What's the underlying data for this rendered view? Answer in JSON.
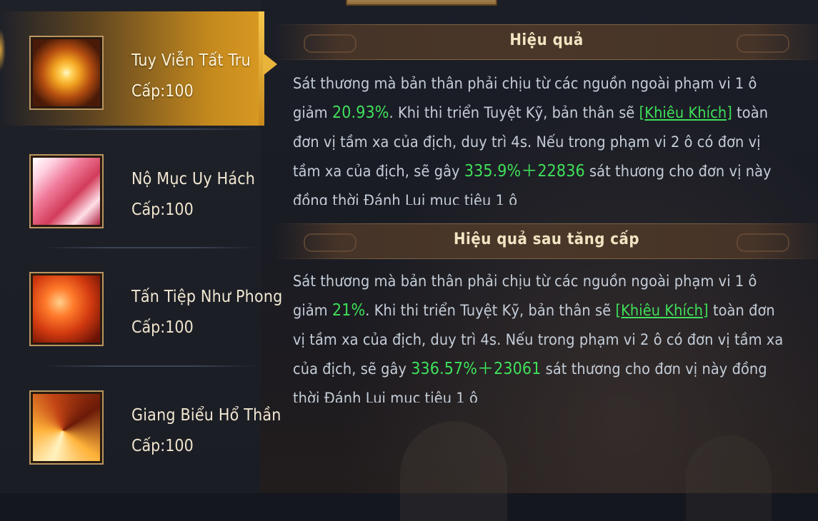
{
  "skills": [
    {
      "name": "Tuy Viễn Tất Tru",
      "level": "Cấp:100",
      "icon": "golden-shield-skill-icon",
      "selected": true
    },
    {
      "name": "Nộ Mục Uy Hách",
      "level": "Cấp:100",
      "icon": "pink-spear-skill-icon",
      "selected": false
    },
    {
      "name": "Tấn Tiệp Như Phong",
      "level": "Cấp:100",
      "icon": "fire-blade-skill-icon",
      "selected": false
    },
    {
      "name": "Giang Biểu Hổ Thần",
      "level": "Cấp:100",
      "icon": "flame-burst-skill-icon",
      "selected": false
    }
  ],
  "effect": {
    "title": "Hiệu quả",
    "text1": "Sát thương mà bản thân phải chịu từ các nguồn ngoài phạm vi 1 ô giảm ",
    "reduction": "20.93%",
    "text2": ". Khi thi triển Tuyệt Kỹ, bản thân sẽ ",
    "status": "[Khiêu Khích]",
    "text3": " toàn đơn vị tầm xa của địch, duy trì 4s. Nếu trong phạm vi 2 ô có đơn vị tầm xa của địch, sẽ gây ",
    "damage": "335.9%＋22836",
    "text4": " sát thương cho đơn vị này đồng thời Đánh Lui mục tiêu 1 ô"
  },
  "upgrade": {
    "title": "Hiệu quả sau tăng cấp",
    "text1": "Sát thương mà bản thân phải chịu từ các nguồn ngoài phạm vi 1 ô giảm ",
    "reduction": "21%",
    "text2": ". Khi thi triển Tuyệt Kỹ, bản thân sẽ ",
    "status": "[Khiêu Khích]",
    "text3": " toàn đơn vị tầm xa của địch, duy trì 4s. Nếu trong phạm vi 2 ô có đơn vị tầm xa của địch, sẽ gây ",
    "damage": "336.57%＋23061",
    "text4": " sát thương cho đơn vị này đồng thời Đánh Lui mục tiêu 1 ô"
  },
  "colors": {
    "highlight": "#3fe05a",
    "selected": "#d99a22",
    "body_text": "#c4cdd8"
  }
}
